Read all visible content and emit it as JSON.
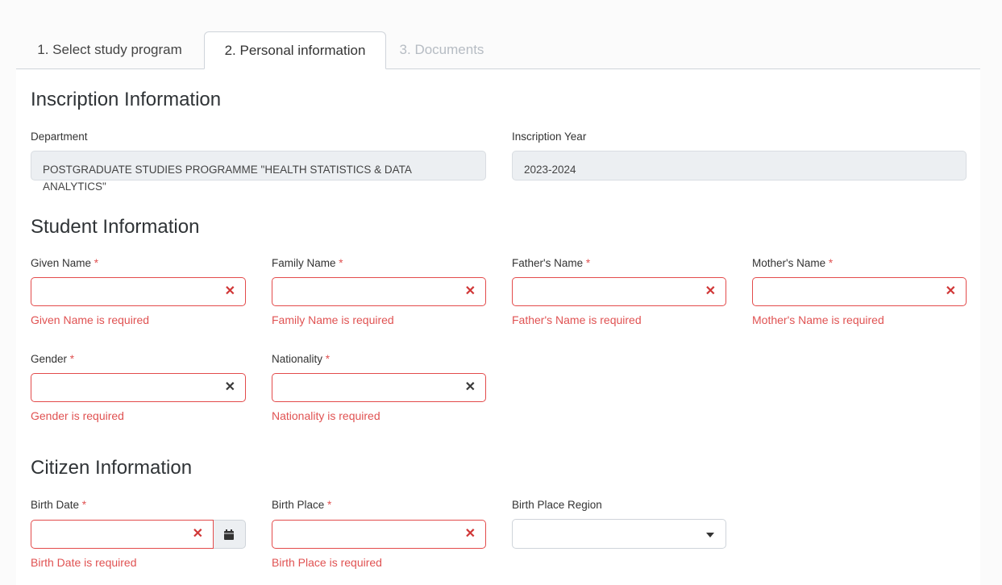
{
  "tabs": [
    {
      "label": "1. Select study program",
      "state": "normal"
    },
    {
      "label": "2. Personal information",
      "state": "active"
    },
    {
      "label": "3. Documents",
      "state": "disabled"
    }
  ],
  "inscription": {
    "title": "Inscription Information",
    "department_label": "Department",
    "department_value": "POSTGRADUATE STUDIES PROGRAMME \"HEALTH STATISTICS & DATA ANALYTICS\"",
    "year_label": "Inscription Year",
    "year_value": "2023-2024"
  },
  "student": {
    "title": "Student Information",
    "given_name": {
      "label": "Given Name",
      "error": "Given Name is required"
    },
    "family_name": {
      "label": "Family Name",
      "error": "Family Name is required"
    },
    "father_name": {
      "label": "Father's Name",
      "error": "Father's Name is required"
    },
    "mother_name": {
      "label": "Mother's Name",
      "error": "Mother's Name is required"
    },
    "gender": {
      "label": "Gender",
      "error": "Gender is required"
    },
    "nationality": {
      "label": "Nationality",
      "error": "Nationality is required"
    }
  },
  "citizen": {
    "title": "Citizen Information",
    "birth_date": {
      "label": "Birth Date",
      "error": "Birth Date is required"
    },
    "birth_place": {
      "label": "Birth Place",
      "error": "Birth Place is required"
    },
    "birth_place_region": {
      "label": "Birth Place Region"
    }
  },
  "required_mark": "*",
  "clear_glyph": "✕",
  "icons": {
    "clear": "clear-icon",
    "calendar": "calendar-icon",
    "dropdown": "chevron-down-icon"
  },
  "colors": {
    "error": "#e05252",
    "border_error": "#e34b4b",
    "readonly_bg": "#eceff2"
  }
}
